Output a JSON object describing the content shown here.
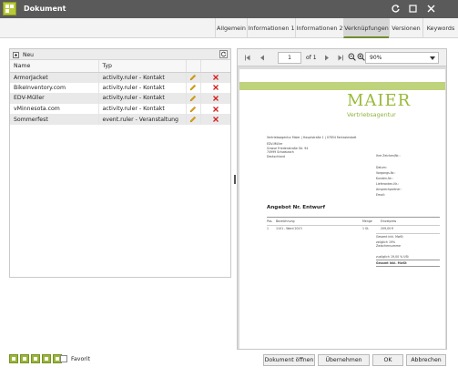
{
  "window": {
    "title": "Dokument"
  },
  "tabs": [
    {
      "label": "Allgemein"
    },
    {
      "label": "Informationen 1"
    },
    {
      "label": "Informationen 2"
    },
    {
      "label": "Verknüpfungen"
    },
    {
      "label": "Versionen"
    },
    {
      "label": "Keywords"
    }
  ],
  "links_panel": {
    "new_label": "Neu",
    "columns": {
      "name": "Name",
      "type": "Typ"
    },
    "rows": [
      {
        "name": "ArmorJacket",
        "type": "activity.ruler - Kontakt"
      },
      {
        "name": "BikeInventory.com",
        "type": "activity.ruler - Kontakt"
      },
      {
        "name": "EDV-Müller",
        "type": "activity.ruler - Kontakt"
      },
      {
        "name": "vMinnesota.com",
        "type": "activity.ruler - Kontakt"
      },
      {
        "name": "Sommerfest",
        "type": "event.ruler - Veranstaltung"
      }
    ]
  },
  "viewer": {
    "page_number": "1",
    "page_count": "of 1",
    "zoom": "90%",
    "doc": {
      "logo": "MAIER",
      "tagline": "Vertriebsagentur",
      "address_lines": [
        "EDV-Müller",
        "Grosse Friedenstraße Str. 94",
        "74999 Schwalzach",
        "Deutschland"
      ],
      "sender_line": "Vertriebsagentur Maier | Hauptstraße 1 | 07654 Fantasiestadt",
      "right_block": [
        "Ihre Zeichen/Nr.:",
        "Datum:",
        "Vorgangs-Nr.:",
        "Kunden-Nr.:",
        "Lieferanten-Nr.:",
        "Ansprechpartner:",
        "Email:"
      ],
      "offer_title": "Angebot Nr. Entwurf",
      "table_headers": [
        "Pos.",
        "Bezeichnung",
        "Menge",
        "Einzelpreis"
      ],
      "table_row": [
        "1",
        "1101 - Word 2013",
        "1 St.",
        "209,00 €"
      ],
      "totals": [
        "Gesamt inkl. MwSt",
        "zzüglich 19%",
        "Zwischensumme",
        "zuzüglich 19,00 % USt",
        "Gesamt inkl. MwSt"
      ]
    }
  },
  "footer": {
    "favorit_label": "Favorit",
    "buttons": {
      "open": "Dokument öffnen",
      "apply": "Übernehmen",
      "ok": "OK",
      "cancel": "Abbrechen"
    }
  },
  "colors": {
    "titlebar": "#5a5a5a",
    "accent_green": "#9aba3a",
    "delete_red": "#d32020",
    "pencil_yellow": "#e0a000"
  }
}
